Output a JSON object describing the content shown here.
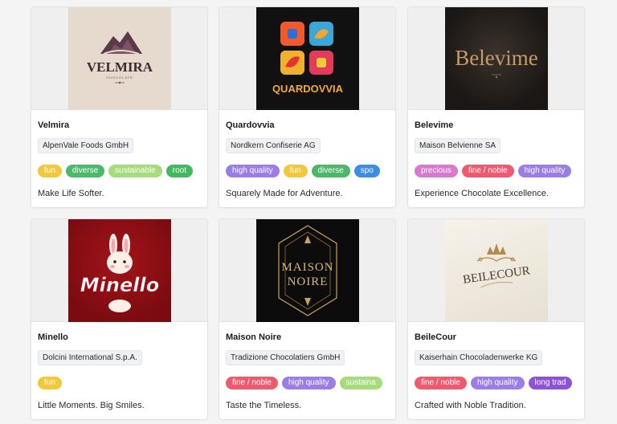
{
  "tag_colors": {
    "fun": "#f2c93a",
    "diverse": "#4cb86a",
    "sustainable": "#a7dc7c",
    "rooted": "#43b85c",
    "high quality": "#9b7de8",
    "sporty": "#3b8ee8",
    "precious": "#d77ad0",
    "fine / noble": "#ef5a6f",
    "long tradition": "#8d52d8"
  },
  "cards": [
    {
      "name": "Velmira",
      "company": "AlpenVale Foods GmbH",
      "tags": [
        "fun",
        "diverse",
        "sustainable",
        "root"
      ],
      "tag_keys": [
        "fun",
        "diverse",
        "sustainable",
        "rooted"
      ],
      "slogan": "Make Life Softer.",
      "logo": {
        "wordmark": "VELMIRA",
        "sub": "CHOCOLATE",
        "icon": "mountain-icon",
        "bg": "#e5d8cc"
      }
    },
    {
      "name": "Quardovvia",
      "company": "Nordkern Confiserie AG",
      "tags": [
        "high quality",
        "fun",
        "diverse",
        "spo"
      ],
      "tag_keys": [
        "high quality",
        "fun",
        "diverse",
        "sporty"
      ],
      "slogan": "Squarely Made for Adventure.",
      "logo": {
        "wordmark": "QUARDOVVIA",
        "icon": "geometric-squares-icon",
        "bg": "#111111"
      }
    },
    {
      "name": "Belevime",
      "company": "Maison Belvienne SA",
      "tags": [
        "precious",
        "fine / noble",
        "high quality"
      ],
      "tag_keys": [
        "precious",
        "fine / noble",
        "high quality"
      ],
      "slogan": "Experience Chocolate Excellence.",
      "logo": {
        "wordmark": "Belevime",
        "bg": "#1e1a17"
      }
    },
    {
      "name": "Minello",
      "company": "Dolcini International S.p.A.",
      "tags": [
        "fun"
      ],
      "tag_keys": [
        "fun"
      ],
      "slogan": "Little Moments. Big Smiles.",
      "logo": {
        "wordmark": "Minello",
        "icon": "bunny-icon",
        "bg": "#8a0d12"
      }
    },
    {
      "name": "Maison Noire",
      "company": "Tradizione Chocolatiers GmbH",
      "tags": [
        "fine / noble",
        "high quality",
        "sustaina"
      ],
      "tag_keys": [
        "fine / noble",
        "high quality",
        "sustainable"
      ],
      "slogan": "Taste the Timeless.",
      "logo": {
        "wordmark": "MAISON",
        "wordmark2": "NOIRE",
        "icon": "art-deco-frame-icon",
        "bg": "#0c0c0c"
      }
    },
    {
      "name": "BeileCour",
      "company": "Kaiserhain Chocoladenwerke KG",
      "tags": [
        "fine / noble",
        "high quality",
        "long trad"
      ],
      "tag_keys": [
        "fine / noble",
        "high quality",
        "long tradition"
      ],
      "slogan": "Crafted with Noble Tradition.",
      "logo": {
        "wordmark": "BEILECOUR",
        "icon": "crown-flourish-icon",
        "bg": "#f1ece3"
      }
    }
  ]
}
